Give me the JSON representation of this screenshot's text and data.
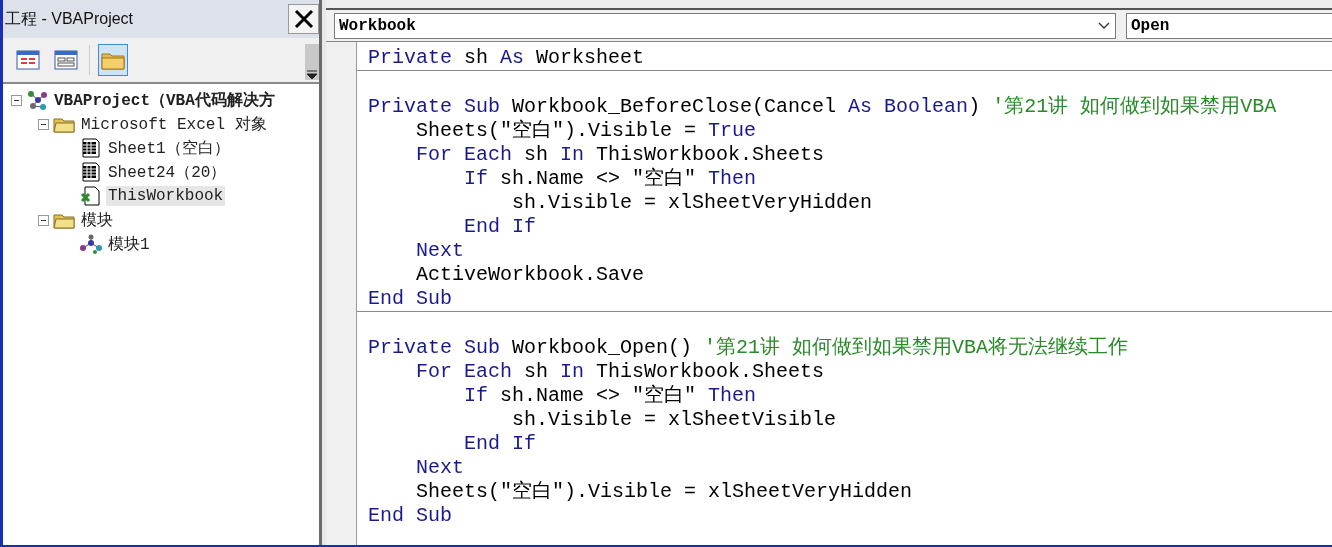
{
  "project_panel": {
    "title": "工程 - VBAProject",
    "toolbar": [
      {
        "kind": "view-code",
        "pressed": false
      },
      {
        "kind": "view-object",
        "pressed": false
      },
      {
        "kind": "folders",
        "pressed": true
      }
    ],
    "tree": [
      {
        "kind": "project",
        "label": "VBAProject（VBA代码解决方",
        "expanded": true,
        "selected": false,
        "children": [
          {
            "kind": "folder",
            "label": "Microsoft Excel 对象",
            "expanded": true,
            "selected": false,
            "children": [
              {
                "kind": "sheet",
                "label": "Sheet1（空白）",
                "selected": false
              },
              {
                "kind": "sheet",
                "label": "Sheet24（20）",
                "selected": false
              },
              {
                "kind": "workbook",
                "label": "ThisWorkbook",
                "selected": true
              }
            ]
          },
          {
            "kind": "folder",
            "label": "模块",
            "expanded": true,
            "selected": false,
            "children": [
              {
                "kind": "module",
                "label": "模块1",
                "selected": false
              }
            ]
          }
        ]
      }
    ]
  },
  "code_window": {
    "object_box": "Workbook",
    "procedure_box": "Open",
    "procedures": [
      {
        "leading_blank": false,
        "lines": [
          {
            "tokens": [
              {
                "kind": "keyword",
                "text": "Private"
              },
              {
                "kind": "plain",
                "text": " sh "
              },
              {
                "kind": "keyword",
                "text": "As"
              },
              {
                "kind": "plain",
                "text": " Worksheet"
              }
            ]
          }
        ]
      },
      {
        "leading_blank": true,
        "lines": [
          {
            "tokens": [
              {
                "kind": "keyword",
                "text": "Private"
              },
              {
                "kind": "keyword",
                "text": " Sub"
              },
              {
                "kind": "plain",
                "text": " Workbook_BeforeClose(Cancel "
              },
              {
                "kind": "keyword",
                "text": "As"
              },
              {
                "kind": "keyword",
                "text": " Boolean"
              },
              {
                "kind": "plain",
                "text": ") "
              },
              {
                "kind": "comment",
                "text": "'第21讲 如何做到如果禁用VBA"
              }
            ],
            "children": [
              {
                "tokens": [
                  {
                    "kind": "plain",
                    "text": "Sheets(\"空白\").Visible = "
                  },
                  {
                    "kind": "keyword",
                    "text": "True"
                  }
                ]
              },
              {
                "tokens": [
                  {
                    "kind": "keyword",
                    "text": "For Each"
                  },
                  {
                    "kind": "plain",
                    "text": " sh "
                  },
                  {
                    "kind": "keyword",
                    "text": "In"
                  },
                  {
                    "kind": "plain",
                    "text": " ThisWorkbook.Sheets"
                  }
                ],
                "children": [
                  {
                    "tokens": [
                      {
                        "kind": "keyword",
                        "text": "If"
                      },
                      {
                        "kind": "plain",
                        "text": " sh.Name <> \"空白\" "
                      },
                      {
                        "kind": "keyword",
                        "text": "Then"
                      }
                    ],
                    "children": [
                      {
                        "tokens": [
                          {
                            "kind": "plain",
                            "text": "sh.Visible = xlSheetVeryHidden"
                          }
                        ]
                      }
                    ]
                  },
                  {
                    "tokens": [
                      {
                        "kind": "keyword",
                        "text": "End If"
                      }
                    ]
                  }
                ]
              },
              {
                "tokens": [
                  {
                    "kind": "keyword",
                    "text": "Next"
                  }
                ]
              },
              {
                "tokens": [
                  {
                    "kind": "plain",
                    "text": "ActiveWorkbook.Save"
                  }
                ]
              }
            ]
          },
          {
            "tokens": [
              {
                "kind": "keyword",
                "text": "End Sub"
              }
            ]
          }
        ]
      },
      {
        "leading_blank": true,
        "lines": [
          {
            "tokens": [
              {
                "kind": "keyword",
                "text": "Private"
              },
              {
                "kind": "keyword",
                "text": " Sub"
              },
              {
                "kind": "plain",
                "text": " Workbook_Open() "
              },
              {
                "kind": "comment",
                "text": "'第21讲 如何做到如果禁用VBA将无法继续工作"
              }
            ],
            "children": [
              {
                "tokens": [
                  {
                    "kind": "keyword",
                    "text": "For Each"
                  },
                  {
                    "kind": "plain",
                    "text": " sh "
                  },
                  {
                    "kind": "keyword",
                    "text": "In"
                  },
                  {
                    "kind": "plain",
                    "text": " ThisWorkbook.Sheets"
                  }
                ],
                "children": [
                  {
                    "tokens": [
                      {
                        "kind": "keyword",
                        "text": "If"
                      },
                      {
                        "kind": "plain",
                        "text": " sh.Name <> \"空白\" "
                      },
                      {
                        "kind": "keyword",
                        "text": "Then"
                      }
                    ],
                    "children": [
                      {
                        "tokens": [
                          {
                            "kind": "plain",
                            "text": "sh.Visible = xlSheetVisible"
                          }
                        ]
                      }
                    ]
                  },
                  {
                    "tokens": [
                      {
                        "kind": "keyword",
                        "text": "End If"
                      }
                    ]
                  }
                ]
              },
              {
                "tokens": [
                  {
                    "kind": "keyword",
                    "text": "Next"
                  }
                ]
              },
              {
                "tokens": [
                  {
                    "kind": "plain",
                    "text": "Sheets(\"空白\").Visible = xlSheetVeryHidden"
                  }
                ]
              }
            ]
          },
          {
            "tokens": [
              {
                "kind": "keyword",
                "text": "End Sub"
              }
            ]
          }
        ]
      }
    ]
  }
}
